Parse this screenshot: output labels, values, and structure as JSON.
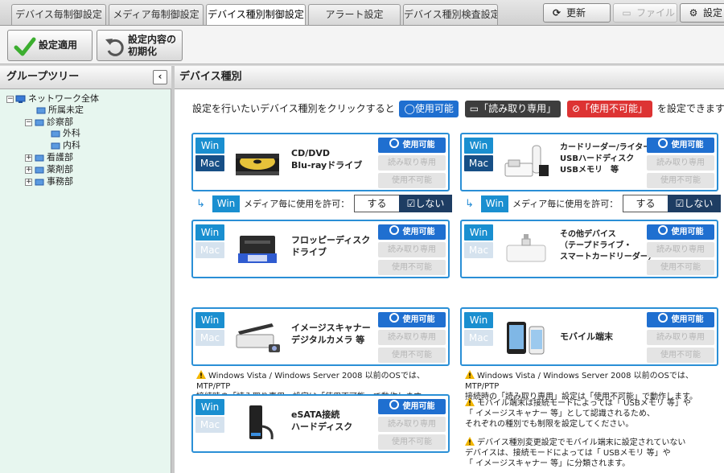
{
  "tabs": [
    {
      "label": "デバイス毎制御設定",
      "active": false
    },
    {
      "label": "メディア毎制御設定",
      "active": false
    },
    {
      "label": "デバイス種別制御設定",
      "active": true
    },
    {
      "label": "アラート設定",
      "active": false
    },
    {
      "label": "デバイス種別検査設定",
      "active": false
    }
  ],
  "top_buttons": {
    "refresh": "更新",
    "file": "ファイル",
    "settings": "設定"
  },
  "toolbar": {
    "apply": "設定適用",
    "reset": "設定内容の\n初期化"
  },
  "left_panel": {
    "title": "グループツリー",
    "tree": [
      {
        "label": "ネットワーク全体",
        "expander": "−"
      },
      {
        "label": "所属未定",
        "expander": ""
      },
      {
        "label": "診察部",
        "expander": "−"
      },
      {
        "label": "外科",
        "expander": ""
      },
      {
        "label": "内科",
        "expander": ""
      },
      {
        "label": "看護部",
        "expander": "+"
      },
      {
        "label": "薬剤部",
        "expander": "+"
      },
      {
        "label": "事務部",
        "expander": "+"
      }
    ]
  },
  "right_panel": {
    "title": "デバイス種別",
    "intro_prefix": "設定を行いたいデバイス種別をクリックすると",
    "chip_allow": "使用可能",
    "chip_read": "「読み取り専用」",
    "chip_deny": "「使用不可能」",
    "intro_suffix": "を設定できます。"
  },
  "state_labels": {
    "allow": "使用可能",
    "read": "読み取り専用",
    "deny": "使用不可能"
  },
  "os_labels": {
    "win": "Win",
    "mac": "Mac"
  },
  "devices": [
    {
      "name": "CD/DVD\nBlu-rayドライブ",
      "mac_enabled": true,
      "icon": "optical-drive-icon"
    },
    {
      "name": "カードリーダー/ライター\nUSBハードディスク\nUSBメモリ　等",
      "mac_enabled": true,
      "icon": "card-reader-icon"
    },
    {
      "name": "フロッピーディスク\nドライブ",
      "mac_enabled": false,
      "icon": "floppy-drive-icon"
    },
    {
      "name": "その他デバイス\n（テープドライブ・\nスマートカードリーダー）",
      "mac_enabled": false,
      "icon": "other-device-icon"
    },
    {
      "name": "イメージスキャナー\nデジタルカメラ 等",
      "mac_enabled": false,
      "icon": "scanner-icon"
    },
    {
      "name": "モバイル端末",
      "mac_enabled": false,
      "icon": "mobile-icon"
    },
    {
      "name": "eSATA接続\nハードディスク",
      "mac_enabled": false,
      "icon": "esata-drive-icon"
    }
  ],
  "media_permit": {
    "label": "メディア毎に使用を許可：",
    "yes": "する",
    "no": "しない"
  },
  "notes": {
    "vista": "Windows Vista / Windows Server 2008 以前のOSでは、MTP/PTP\n接続時の「読み取り専用」設定は「使用不可能」で動作します。",
    "mobile1": "モバイル端末は接続モードによっては「 USBメモリ 等」や\n「 イメージスキャナー 等」として認識されるため、\nそれぞれの種別でも制限を設定してください。",
    "mobile2": "デバイス種別変更設定でモバイル端末に設定されていない\nデバイスは、接続モードによっては「 USBメモリ 等」や\n「 イメージスキャナー 等」に分類されます。"
  },
  "colors": {
    "accent": "#1f6fd0",
    "card_border": "#2a8fd6",
    "deny": "#dd3333",
    "tree_bg": "#e7f6ef"
  }
}
